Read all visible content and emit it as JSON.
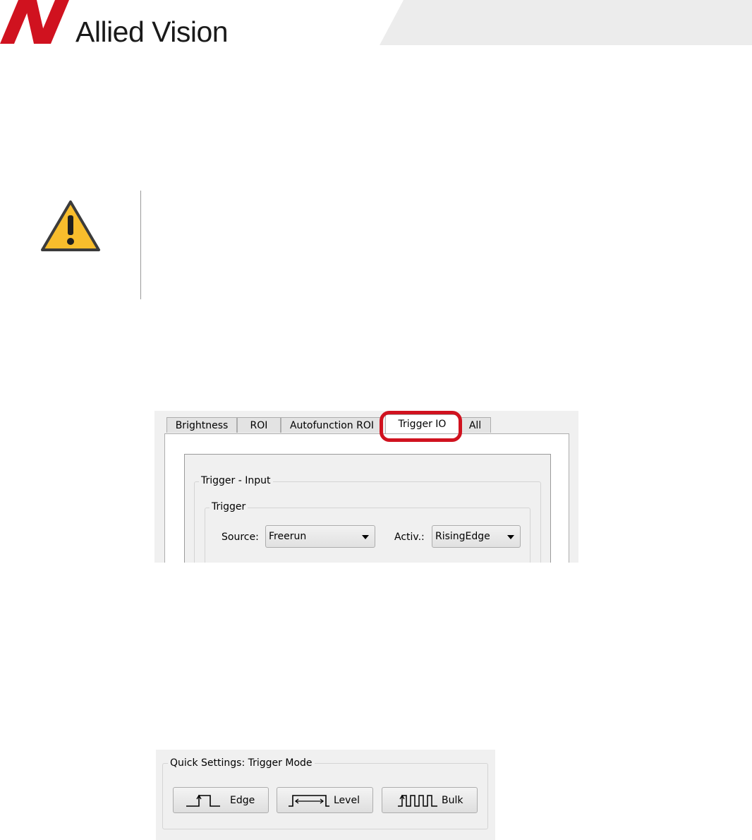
{
  "header": {
    "brand": "Allied Vision",
    "colors": {
      "logo_red": "#d0121f",
      "band_grey": "#ececec"
    }
  },
  "warning": {
    "icon": "warning-icon",
    "colors": {
      "fill": "#f8bd2c",
      "stroke": "#3b3b3b"
    }
  },
  "tabs_panel": {
    "tabs": [
      {
        "label": "Brightness"
      },
      {
        "label": "ROI"
      },
      {
        "label": "Autofunction ROI"
      },
      {
        "label": "Trigger IO",
        "active": true
      },
      {
        "label": "All"
      }
    ],
    "highlight_color": "#d0121f",
    "trigger_input_group": "Trigger - Input",
    "trigger_group": "Trigger",
    "source_label": "Source:",
    "source_value": "Freerun",
    "activation_label": "Activ.:",
    "activation_value": "RisingEdge"
  },
  "quick_settings": {
    "title": "Quick Settings: Trigger Mode",
    "buttons": [
      {
        "label": "Edge",
        "icon": "edge-trigger-icon"
      },
      {
        "label": "Level",
        "icon": "level-trigger-icon"
      },
      {
        "label": "Bulk",
        "icon": "bulk-trigger-icon"
      }
    ]
  }
}
